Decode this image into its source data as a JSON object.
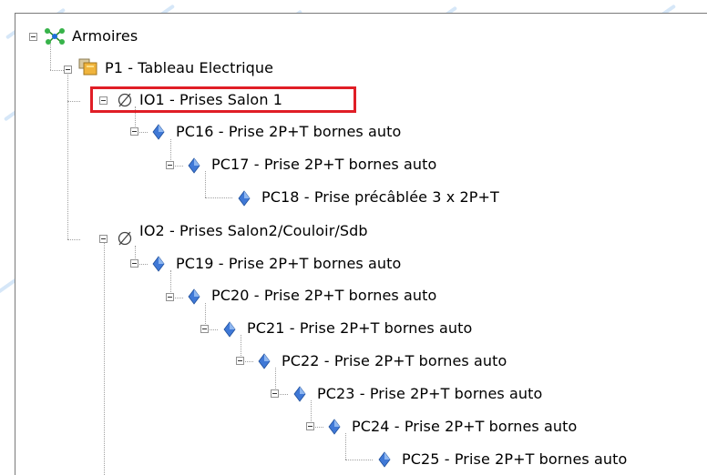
{
  "tree": {
    "root": {
      "label": "Armoires",
      "icon": "network-icon"
    },
    "cabinet": {
      "label": "P1 - Tableau Electrique",
      "icon": "cabinet-icon"
    },
    "circuits": [
      {
        "label": "IO1 - Prises Salon 1",
        "icon": "empty-set-icon",
        "highlighted": true,
        "points": [
          {
            "label": "PC16 - Prise 2P+T bornes auto"
          },
          {
            "label": "PC17 - Prise 2P+T bornes auto"
          },
          {
            "label": "PC18 - Prise précâblée 3 x 2P+T"
          }
        ]
      },
      {
        "label": "IO2 - Prises Salon2/Couloir/Sdb",
        "icon": "empty-set-icon",
        "points": [
          {
            "label": "PC19 - Prise 2P+T bornes auto"
          },
          {
            "label": "PC20 - Prise 2P+T bornes auto"
          },
          {
            "label": "PC21 - Prise 2P+T bornes auto"
          },
          {
            "label": "PC22 - Prise 2P+T bornes auto"
          },
          {
            "label": "PC23 - Prise 2P+T bornes auto"
          },
          {
            "label": "PC24 - Prise 2P+T bornes auto"
          },
          {
            "label": "PC25 - Prise 2P+T bornes auto"
          }
        ]
      }
    ]
  },
  "colors": {
    "highlight": "#e01e26",
    "point_icon": "#3f78d6",
    "cabinet_icon": "#f0b43c"
  }
}
